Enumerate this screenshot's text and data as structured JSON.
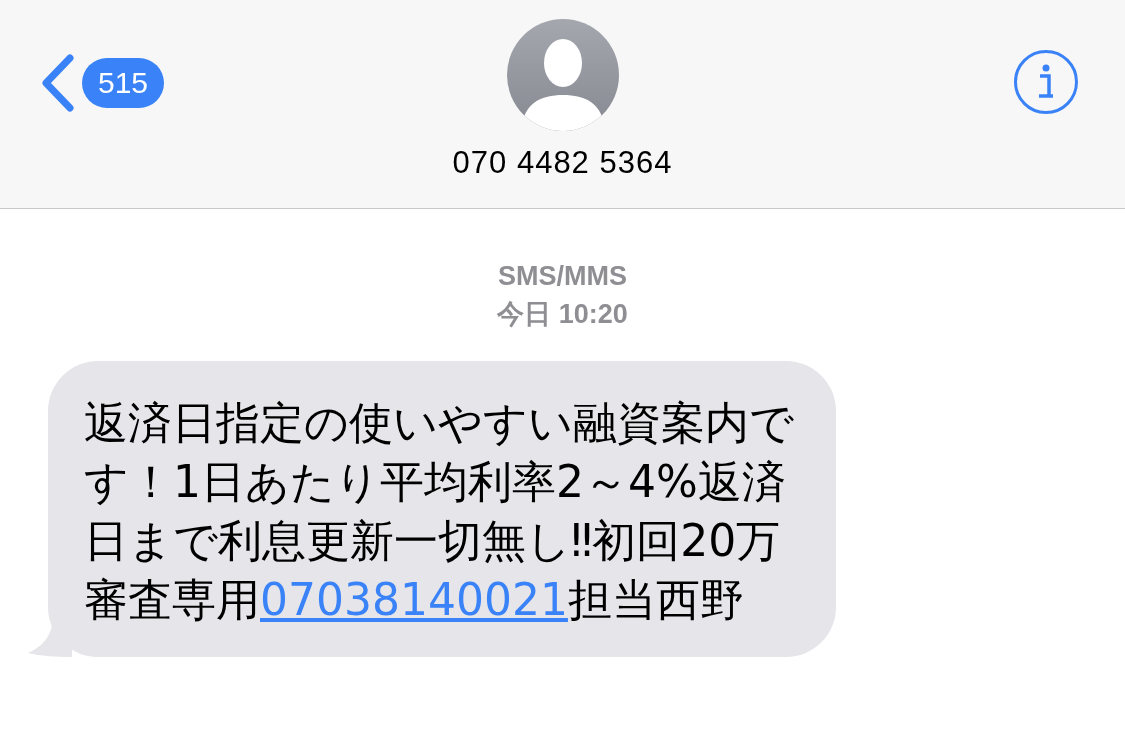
{
  "header": {
    "back_count": "515",
    "contact": "070 4482 5364"
  },
  "conversation": {
    "service": "SMS/MMS",
    "timestamp": "今日 10:20",
    "messages": [
      {
        "kind": "incoming",
        "before": "返済日指定の使いやすい融資案内です！1日あたり平均利率2～4%返済日まで利息更新一切無し‼初回20万審査専用",
        "link": "07038140021",
        "after": "担当西野"
      }
    ]
  }
}
